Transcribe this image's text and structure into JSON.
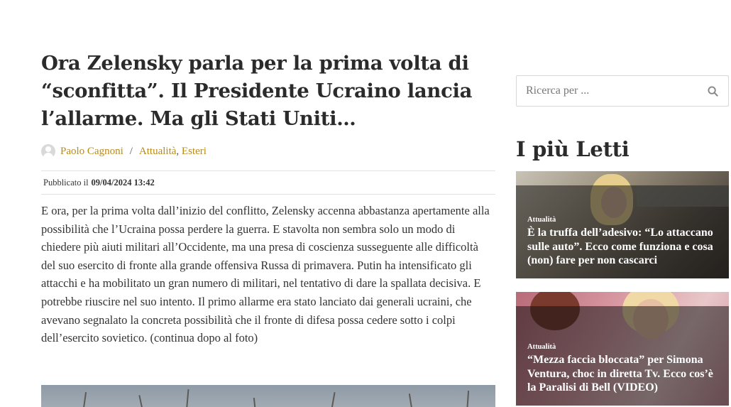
{
  "article": {
    "title": "Ora Zelensky parla per la prima volta di “sconfitta”. Il Presidente Ucraino lancia l’allarme. Ma gli Stati Uniti…",
    "author": "Paolo Cagnoni",
    "separator": "/",
    "categories": [
      "Attualità",
      "Esteri"
    ],
    "category_comma": ",",
    "published_label": "Pubblicato il",
    "published_date": "09/04/2024 13:42",
    "body": "E ora, per la prima volta dall’inizio del conflitto, Zelensky accenna abbastanza apertamente alla possibilità che l’Ucraina possa perdere la guerra. E stavolta non sembra solo un modo di chiedere più aiuti militari all’Occidente, ma una presa di coscienza susseguente alle difficoltà del suo esercito di fronte alla grande offensiva Russa di primavera. Putin ha intensificato gli attacchi e ha mobilitato un gran numero di militari, nel tentativo di dare la spallata decisiva. E potrebbe riuscire nel suo intento. Il primo allarme era stato lanciato dai generali ucraini, che avevano segnalato la concreta possibilità che il fronte di difesa possa cedere sotto i colpi dell’esercito sovietico. (continua dopo al foto)"
  },
  "sidebar": {
    "search": {
      "placeholder": "Ricerca per ...",
      "value": "",
      "icon": "search-icon"
    },
    "widget_title": "I più Letti",
    "posts": [
      {
        "category": "Attualità",
        "title": "È la truffa dell’adesivo: “Lo attaccano sulle auto”. Ecco come funziona e cosa (non) fare per non cascarci"
      },
      {
        "category": "Attualità",
        "title": "“Mezza faccia bloccata” per Simona Ventura, choc in diretta Tv. Ecco cos’è la Paralisi di Bell (VIDEO)"
      }
    ]
  },
  "colors": {
    "link": "#b98a18",
    "title": "#2b2b2b",
    "text": "#333333",
    "border": "#e2e2e2"
  }
}
